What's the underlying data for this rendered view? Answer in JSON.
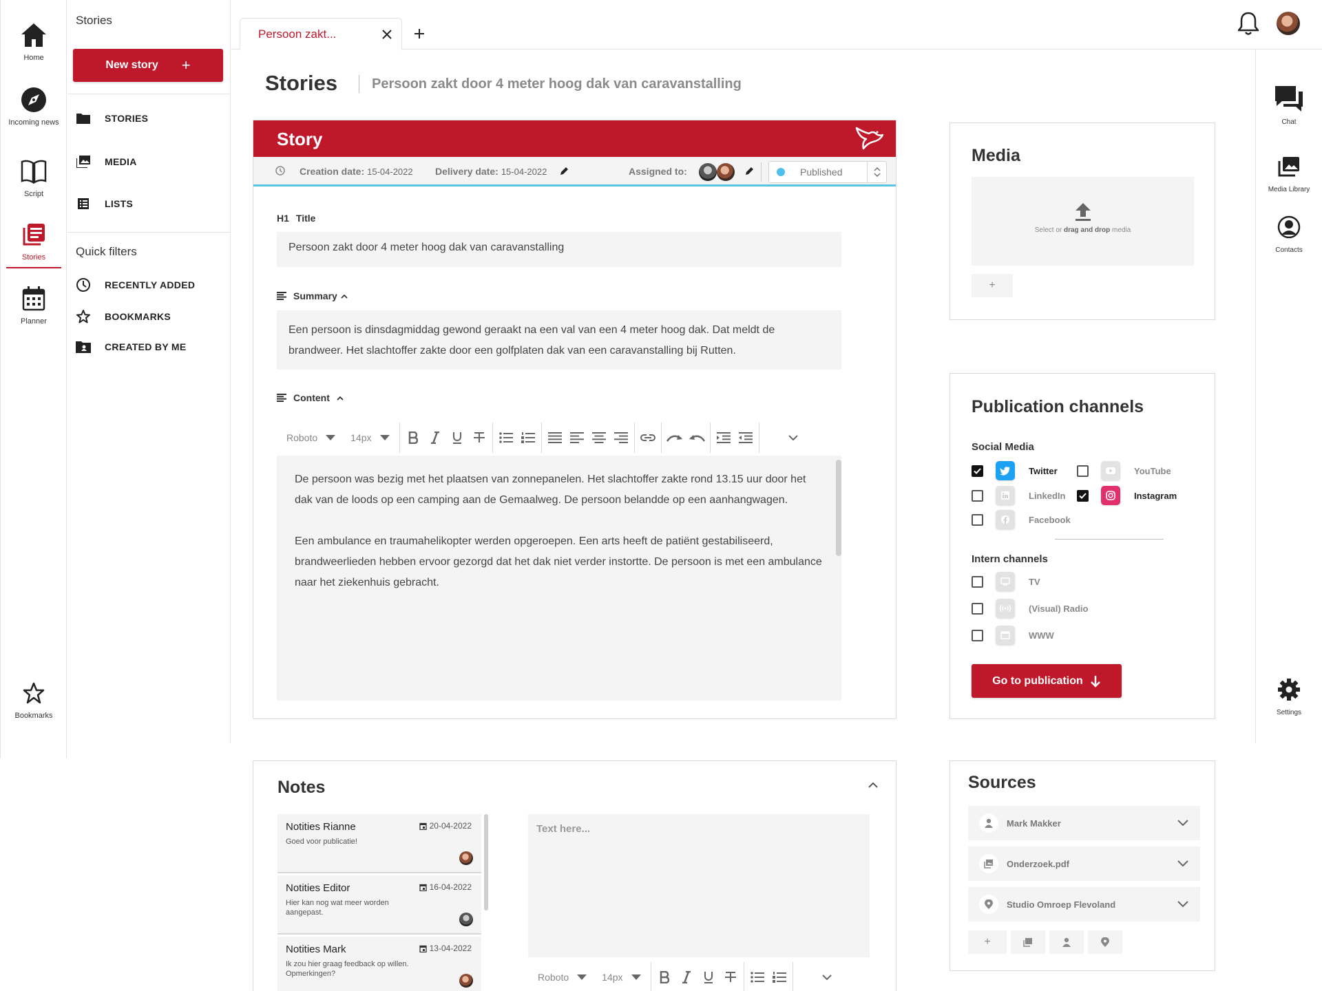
{
  "colors": {
    "brand": "#c0182b",
    "accent_line": "#5bc3e6",
    "status_dot": "#4fc0ea",
    "twitter": "#1da1f2",
    "instagram": "#e1306c"
  },
  "left_rail": [
    {
      "label": "Home",
      "icon": "home-icon"
    },
    {
      "label": "Incoming news",
      "icon": "compass-icon"
    },
    {
      "label": "Script",
      "icon": "book-icon"
    },
    {
      "label": "Stories",
      "icon": "stories-icon"
    },
    {
      "label": "Planner",
      "icon": "calendar-icon"
    },
    {
      "label": "Bookmarks",
      "icon": "star-icon"
    }
  ],
  "side_panel": {
    "header": "Stories",
    "new_story_label": "New story",
    "items": [
      {
        "label": "STORIES",
        "icon": "folder-icon"
      },
      {
        "label": "MEDIA",
        "icon": "images-icon"
      },
      {
        "label": "LISTS",
        "icon": "list-icon"
      }
    ],
    "quick_filters_title": "Quick filters",
    "quick_filters": [
      {
        "label": "RECENTLY ADDED",
        "icon": "clock-icon"
      },
      {
        "label": "BOOKMARKS",
        "icon": "star-outline-icon"
      },
      {
        "label": "CREATED BY ME",
        "icon": "person-folder-icon"
      }
    ]
  },
  "tabs": [
    {
      "label": "Persoon zakt..."
    }
  ],
  "right_rail": [
    {
      "label": "Chat",
      "icon": "chat-icon"
    },
    {
      "label": "Media Library",
      "icon": "media-library-icon"
    },
    {
      "label": "Contacts",
      "icon": "contacts-icon"
    },
    {
      "label": "Settings",
      "icon": "gear-icon"
    }
  ],
  "page": {
    "title": "Stories",
    "subtitle": "Persoon zakt door 4 meter hoog dak van caravanstalling"
  },
  "story": {
    "header": "Story",
    "creation_label": "Creation date:",
    "creation_value": "15-04-2022",
    "delivery_label": "Delivery date:",
    "delivery_value": "15-04-2022",
    "assigned_label": "Assigned to:",
    "status": "Published",
    "title_prefix": "H1",
    "title_label": "Title",
    "title_value": "Persoon zakt door 4 meter hoog dak van caravanstalling",
    "summary_label": "Summary",
    "summary_value": "Een persoon is dinsdagmiddag gewond geraakt na een val van een 4 meter hoog dak. Dat meldt de brandweer. Het slachtoffer zakte door een golfplaten dak van een caravanstalling bij Rutten.",
    "content_label": "Content",
    "toolbar_font": "Roboto",
    "toolbar_size": "14px",
    "content_paragraphs": [
      "De persoon was bezig met het plaatsen van zonnepanelen. Het slachtoffer zakte rond 13.15 uur door het dak van de loods op een camping aan de Gemaalweg. De persoon belandde op een aanhangwagen.",
      "Een ambulance en traumahelikopter werden opgeroepen. Een arts heeft de patiënt gestabiliseerd, brandweerlieden hebben ervoor gezorgd dat het dak niet verder instortte. De persoon is met een ambulance naar het ziekenhuis gebracht."
    ]
  },
  "media": {
    "title": "Media",
    "drop_prefix": "Select or ",
    "drop_bold": "drag and drop",
    "drop_suffix": " media",
    "add_label": "+"
  },
  "publication": {
    "title": "Publication channels",
    "social_label": "Social Media",
    "intern_label": "Intern channels",
    "social": [
      {
        "label": "Twitter",
        "checked": true,
        "icon": "twitter-icon"
      },
      {
        "label": "YouTube",
        "checked": false,
        "icon": "youtube-icon"
      },
      {
        "label": "LinkedIn",
        "checked": false,
        "icon": "linkedin-icon"
      },
      {
        "label": "Instagram",
        "checked": true,
        "icon": "instagram-icon"
      },
      {
        "label": "Facebook",
        "checked": false,
        "icon": "facebook-icon"
      }
    ],
    "intern": [
      {
        "label": "TV",
        "checked": false,
        "icon": "tv-icon"
      },
      {
        "label": "(Visual) Radio",
        "checked": false,
        "icon": "radio-icon"
      },
      {
        "label": "WWW",
        "checked": false,
        "icon": "www-icon"
      }
    ],
    "button_label": "Go to publication"
  },
  "notes": {
    "title": "Notes",
    "placeholder": "Text here...",
    "items": [
      {
        "title": "Notities Rianne",
        "date": "20-04-2022",
        "text": "Goed voor publicatie!"
      },
      {
        "title": "Notities Editor",
        "date": "16-04-2022",
        "text": "Hier kan nog wat meer worden aangepast."
      },
      {
        "title": "Notities Mark",
        "date": "13-04-2022",
        "text": "Ik zou hier graag feedback op willen. Opmerkingen?"
      }
    ],
    "toolbar_font": "Roboto",
    "toolbar_size": "14px"
  },
  "sources": {
    "title": "Sources",
    "items": [
      {
        "label": "Mark Makker",
        "icon": "person-icon"
      },
      {
        "label": "Onderzoek.pdf",
        "icon": "file-icon"
      },
      {
        "label": "Studio Omroep Flevoland",
        "icon": "location-icon"
      }
    ],
    "add_label": "+"
  }
}
